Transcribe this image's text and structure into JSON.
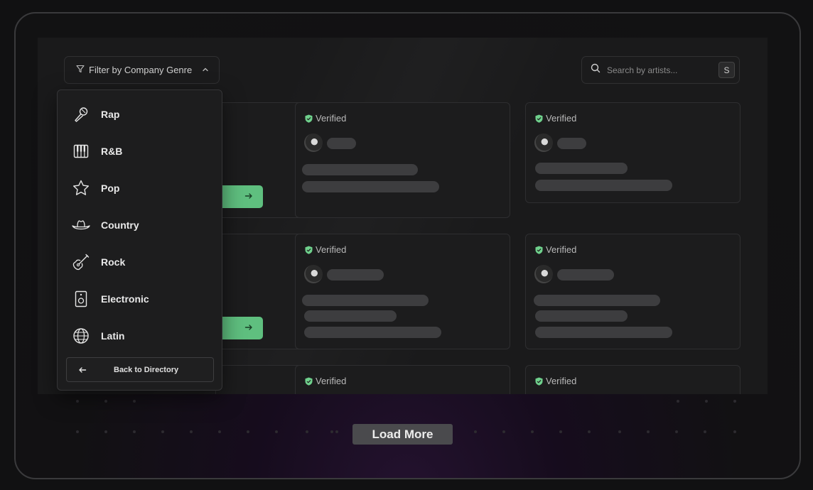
{
  "filter": {
    "label": "Filter by Company Genre"
  },
  "search": {
    "placeholder": "Search by artists...",
    "shortcut": "S"
  },
  "cards": {
    "verified_label": "Verified"
  },
  "genres": [
    {
      "label": "Rap",
      "icon": "microphone-icon"
    },
    {
      "label": "R&B",
      "icon": "piano-icon"
    },
    {
      "label": "Pop",
      "icon": "star-icon"
    },
    {
      "label": "Country",
      "icon": "cowboy-hat-icon"
    },
    {
      "label": "Rock",
      "icon": "guitar-icon"
    },
    {
      "label": "Electronic",
      "icon": "speaker-icon"
    },
    {
      "label": "Latin",
      "icon": "globe-icon"
    }
  ],
  "back_button": {
    "label": "Back to Directory"
  },
  "load_more": {
    "label": "Load More"
  },
  "colors": {
    "accent_green": "#5fbf7f",
    "verified_green": "#6fd08c"
  }
}
